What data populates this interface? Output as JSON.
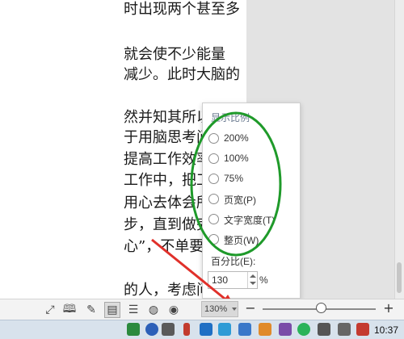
{
  "document": {
    "lines": [
      "时出现两个甚至多",
      "就会使不少能量",
      "减少。此时大脑的",
      "然并知其所以然”，",
      "于用脑思考问题，",
      "提高工作效率，",
      "工作中，把工作本",
      "用心去体会所要",
      "步，直到做完它。",
      "心”，不单要把心",
      "的人，考虑问题往"
    ]
  },
  "zoom_popup": {
    "title": "显示比例",
    "options": [
      {
        "label": "200%"
      },
      {
        "label": "100%"
      },
      {
        "label": "75%"
      },
      {
        "label": "页宽(P)"
      },
      {
        "label": "文字宽度(T)"
      },
      {
        "label": "整页(W)"
      }
    ],
    "percent_label": "百分比(E):",
    "percent_value": "130",
    "percent_sign": "%"
  },
  "status_bar": {
    "zoom_value": "130%",
    "zoom_out": "−",
    "zoom_in": "+",
    "zoom_slider_level": 0.52,
    "icons": [
      "fit-page-icon",
      "reading-mode-icon",
      "edit-pen-icon",
      "page-view-icon",
      "outline-view-icon",
      "web-view-icon",
      "eye-protect-icon"
    ]
  },
  "taskbar": {
    "clock": "10:37"
  },
  "annotation_colors": {
    "ellipse": "#1f9a2a",
    "arrow": "#e0302a"
  }
}
